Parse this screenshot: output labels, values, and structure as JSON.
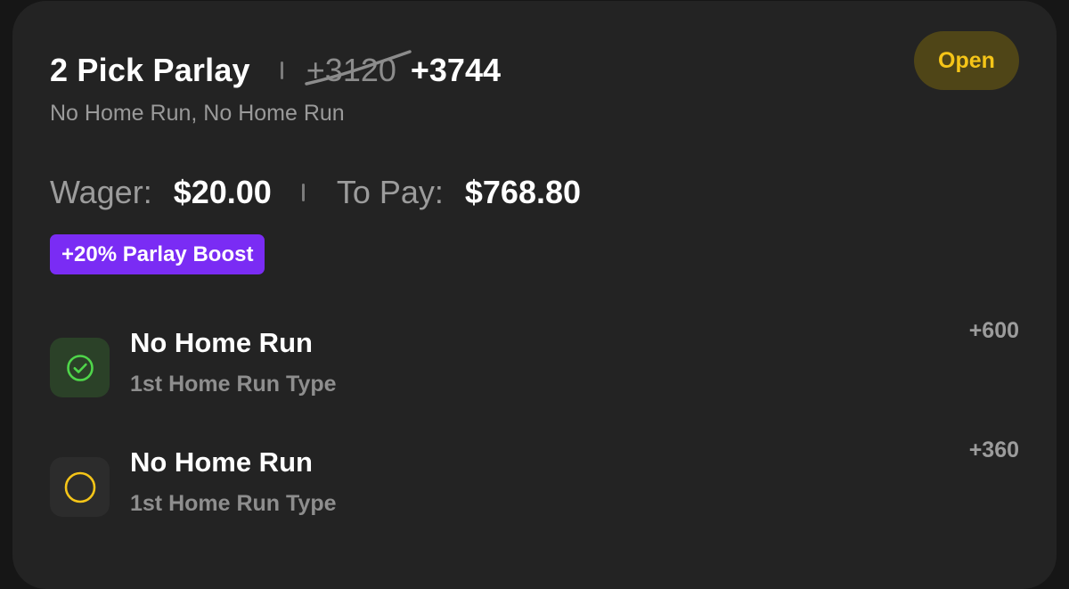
{
  "bet": {
    "title": "2 Pick Parlay",
    "original_odds": "+3120",
    "boosted_odds": "+3744",
    "subtitle": "No Home Run, No Home Run",
    "status": "Open",
    "wager_label": "Wager:",
    "wager_value": "$20.00",
    "to_pay_label": "To Pay:",
    "to_pay_value": "$768.80",
    "boost_label": "+20% Parlay Boost"
  },
  "legs": [
    {
      "name": "No Home Run",
      "market": "1st Home Run Type",
      "odds": "+600",
      "state": "won",
      "icon": "check-circle-icon"
    },
    {
      "name": "No Home Run",
      "market": "1st Home Run Type",
      "odds": "+360",
      "state": "open",
      "icon": "open-circle-icon"
    }
  ],
  "colors": {
    "background": "#161616",
    "card": "#232323",
    "status_text": "#f5c518",
    "status_bg": "#4f4517",
    "boost_bg": "#7a2cf4",
    "won_green": "#4fd64a",
    "open_yellow": "#f5c518"
  }
}
